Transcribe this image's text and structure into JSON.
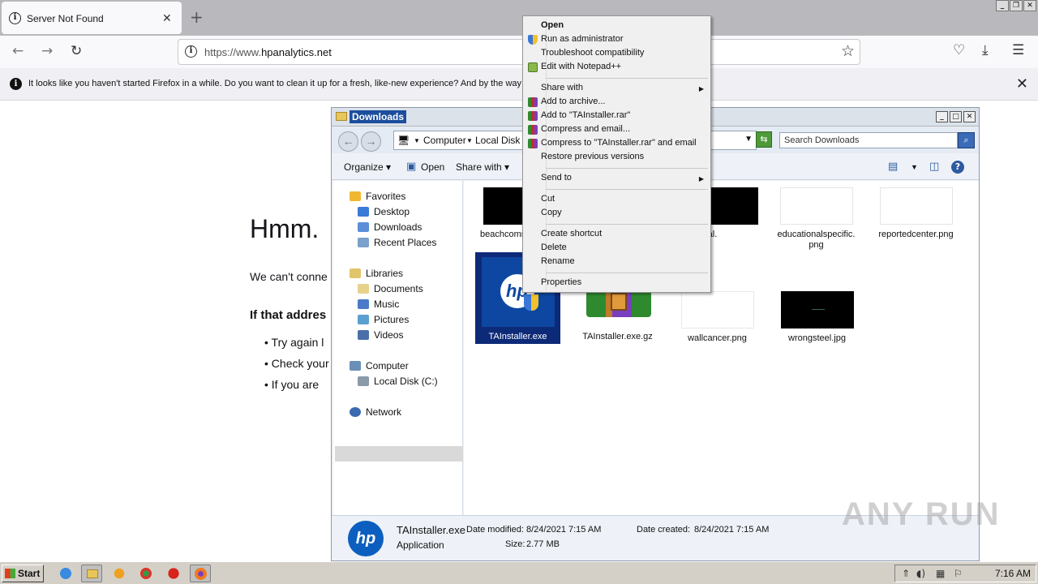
{
  "browser": {
    "tab_title": "Server Not Found",
    "new_tab_symbol": "+",
    "url_prefix": "https://www.",
    "url_domain": "hpanalytics.net",
    "notification": "It looks like you haven't started Firefox in a while. Do you want to clean it up for a fresh, like-new experience? And by the way",
    "error": {
      "heading": "Hmm. ",
      "line1": "We can't conne",
      "sub": "If that addres",
      "bullets": [
        "Try again l",
        "Check your",
        "If you are"
      ]
    }
  },
  "explorer": {
    "title": "Downloads",
    "breadcrumb": [
      "Computer",
      "Local Disk (C"
    ],
    "search_placeholder": "Search Downloads",
    "commands": {
      "organize": "Organize",
      "open": "Open",
      "share_with": "Share with"
    },
    "nav": {
      "favorites": "Favorites",
      "favorites_items": [
        "Desktop",
        "Downloads",
        "Recent Places"
      ],
      "libraries": "Libraries",
      "libraries_items": [
        "Documents",
        "Music",
        "Pictures",
        "Videos"
      ],
      "computer": "Computer",
      "computer_items": [
        "Local Disk (C:)"
      ],
      "network": "Network"
    },
    "files": [
      {
        "name": "beachcomn",
        "thumb": "black"
      },
      {
        "name": "ionternal.\njpg",
        "thumb": "black"
      },
      {
        "name": "educationalspecific.\npng",
        "thumb": "white"
      },
      {
        "name": "reportedcenter.png",
        "thumb": "white"
      },
      {
        "name": "TAInstaller.exe",
        "thumb": "hp"
      },
      {
        "name": "TAInstaller.exe.gz",
        "thumb": "rar"
      },
      {
        "name": "wallcancer.png",
        "thumb": "white"
      },
      {
        "name": "wrongsteel.jpg",
        "thumb": "black"
      }
    ],
    "details": {
      "filename": "TAInstaller.exe",
      "type": "Application",
      "modified_label": "Date modified:",
      "modified": "8/24/2021 7:15 AM",
      "size_label": "Size:",
      "size": "2.77 MB",
      "created_label": "Date created:",
      "created": "8/24/2021 7:15 AM"
    }
  },
  "context_menu": {
    "items": [
      {
        "label": "Open",
        "bold": true,
        "icon": ""
      },
      {
        "label": "Run as administrator",
        "icon": "shield-icon"
      },
      {
        "label": "Troubleshoot compatibility",
        "icon": ""
      },
      {
        "label": "Edit with Notepad++",
        "icon": "notepad-icon"
      },
      {
        "label": "Share with",
        "submenu": true,
        "icon": ""
      },
      {
        "label": "Add to archive...",
        "icon": "winrar-icon"
      },
      {
        "label": "Add to \"TAInstaller.rar\"",
        "icon": "winrar-icon"
      },
      {
        "label": "Compress and email...",
        "icon": "winrar-icon"
      },
      {
        "label": "Compress to \"TAInstaller.rar\" and email",
        "icon": "winrar-icon"
      },
      {
        "label": "Restore previous versions",
        "icon": ""
      },
      {
        "label": "Send to",
        "submenu": true,
        "icon": ""
      },
      {
        "label": "Cut",
        "icon": ""
      },
      {
        "label": "Copy",
        "icon": ""
      },
      {
        "label": "Create shortcut",
        "icon": ""
      },
      {
        "label": "Delete",
        "icon": ""
      },
      {
        "label": "Rename",
        "icon": ""
      },
      {
        "label": "Properties",
        "icon": ""
      }
    ]
  },
  "taskbar": {
    "start_label": "Start",
    "clock": "7:16 AM"
  },
  "watermark": "ANY RUN",
  "colors": {
    "selection": "#0d2a78",
    "explorer_titlebar_text_bg": "#1c4e9c"
  }
}
